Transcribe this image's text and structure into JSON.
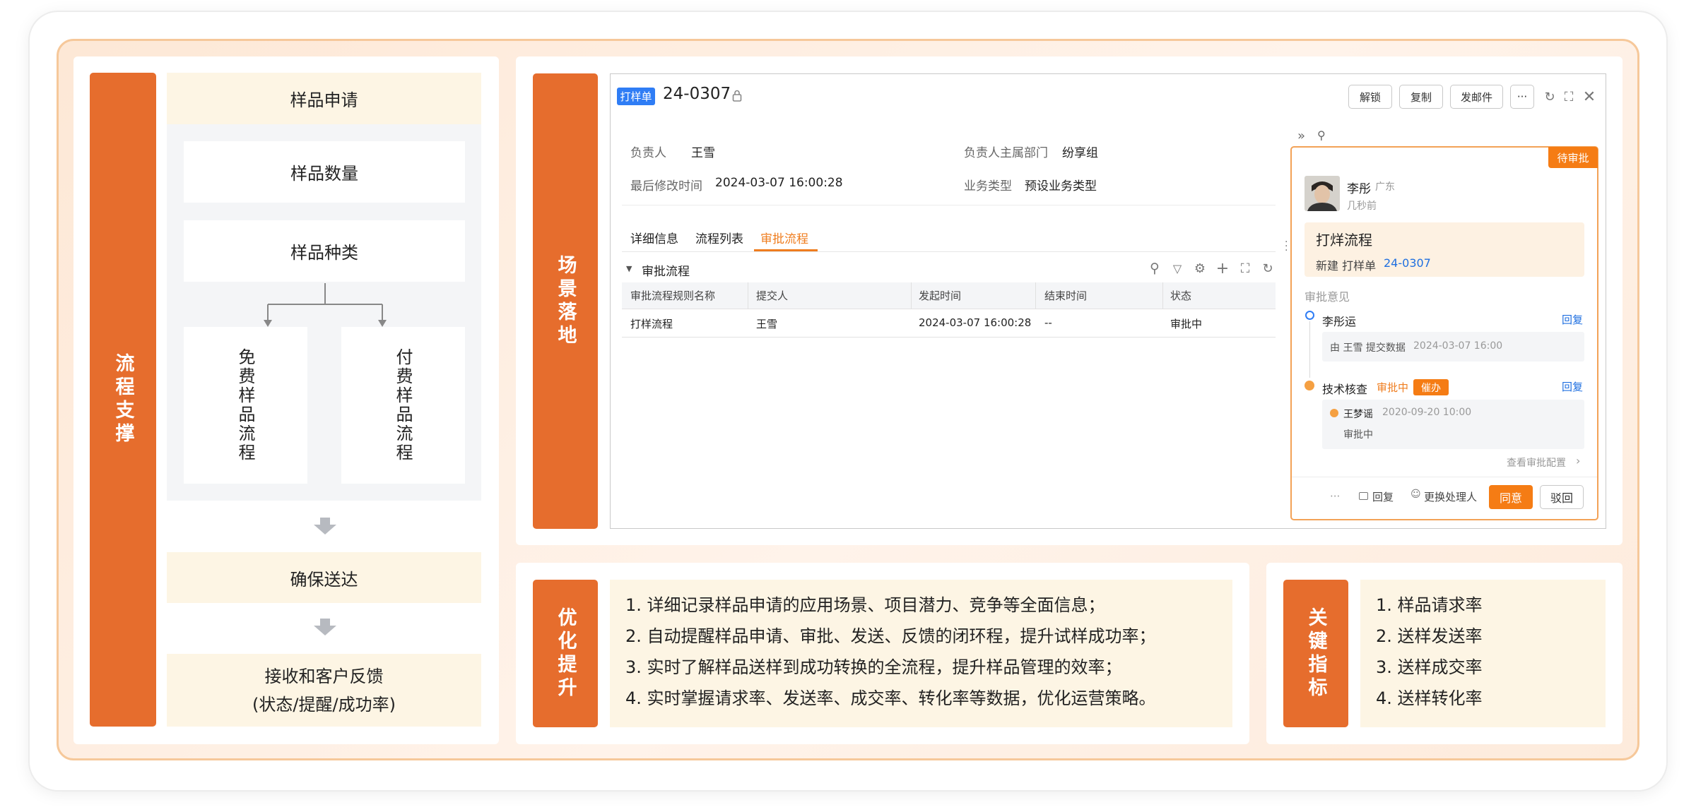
{
  "left": {
    "title": "流程支撑",
    "sample_apply": "样品申请",
    "sample_qty": "样品数量",
    "sample_type": "样品种类",
    "free_flow": "免费样品流程",
    "paid_flow": "付费样品流程",
    "ensure": "确保送达",
    "receive_l1": "接收和客户反馈",
    "receive_l2": "(状态/提醒/成功率)"
  },
  "scene": {
    "title": "场景落地",
    "badge": "打样单",
    "doc_no": "24-0307",
    "buttons": {
      "unlock": "解锁",
      "copy": "复制",
      "mail": "发邮件",
      "more": "···"
    },
    "fields": {
      "owner_label": "负责人",
      "owner_value": "王雪",
      "dept_label": "负责人主属部门",
      "dept_value": "纷享组",
      "modified_label": "最后修改时间",
      "modified_value": "2024-03-07 16:00:28",
      "biz_label": "业务类型",
      "biz_value": "预设业务类型"
    },
    "tabs": [
      "详细信息",
      "流程列表",
      "审批流程"
    ],
    "section_title": "审批流程",
    "table": {
      "headers": [
        "审批流程规则名称",
        "提交人",
        "发起时间",
        "结束时间",
        "状态"
      ],
      "row": [
        "打样流程",
        "王雪",
        "2024-03-07 16:00:28",
        "--",
        "审批中"
      ]
    },
    "approval": {
      "status_tag": "待审批",
      "user": "李彤",
      "region": "广东",
      "time_ago": "几秒前",
      "flow_title": "打烊流程",
      "new_label": "新建 打样单",
      "new_no": "24-0307",
      "opinion_label": "审批意见",
      "node1_name": "李彤运",
      "reply": "回复",
      "node1_detail": "由 王雪 提交数据",
      "node1_time": "2024-03-07 16:00",
      "node2_name": "技术核查",
      "node2_status": "审批中",
      "urge": "催办",
      "node2_user": "王梦谣",
      "node2_time": "2020-09-20 10:00",
      "node2_state": "审批中",
      "view_config": "查看审批配置",
      "footer_more": "···",
      "footer_reply": "回复",
      "footer_change": "更换处理人",
      "agree": "同意",
      "reject": "驳回"
    }
  },
  "optimize": {
    "title": "优化提升",
    "items": [
      "1. 详细记录样品申请的应用场景、项目潜力、竞争等全面信息；",
      "2. 自动提醒样品申请、审批、发送、反馈的闭环程，提升试样成功率；",
      "3. 实时了解样品送样到成功转换的全流程，提升样品管理的效率；",
      "4. 实时掌握请求率、发送率、成交率、转化率等数据，优化运营策略。"
    ]
  },
  "metrics": {
    "title": "关键指标",
    "items": [
      "1. 样品请求率",
      "2. 送样发送率",
      "3. 送样成交率",
      "4. 送样转化率"
    ]
  },
  "colors": {
    "accent": "#e66d2d",
    "cream": "#fdf5e4",
    "link": "#1f6fe0",
    "orange_btn": "#f57c14"
  }
}
